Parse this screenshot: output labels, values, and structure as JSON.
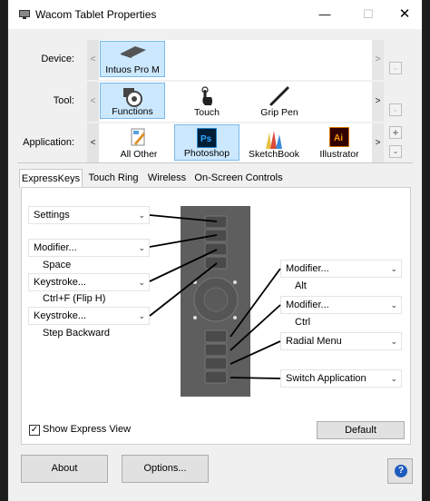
{
  "window": {
    "title": "Wacom Tablet Properties"
  },
  "titlebar": {
    "minimize": "—",
    "maximize": "☐",
    "close": "✕"
  },
  "device": {
    "label": "Device:",
    "items": [
      {
        "name": "Intuos Pro M",
        "icon": "tablet-icon",
        "selected": true
      }
    ]
  },
  "tool": {
    "label": "Tool:",
    "items": [
      {
        "name": "Functions",
        "icon": "functions-icon",
        "selected": true
      },
      {
        "name": "Touch",
        "icon": "touch-icon",
        "selected": false
      },
      {
        "name": "Grip Pen",
        "icon": "pen-icon",
        "selected": false
      }
    ]
  },
  "application": {
    "label": "Application:",
    "items": [
      {
        "name": "All Other",
        "icon": "all-other-icon",
        "selected": false
      },
      {
        "name": "Photoshop",
        "icon": "photoshop-icon",
        "icon_text": "Ps",
        "selected": true
      },
      {
        "name": "SketchBook",
        "icon": "sketchbook-icon",
        "selected": false
      },
      {
        "name": "Illustrator",
        "icon": "illustrator-icon",
        "icon_text": "Ai",
        "selected": false
      }
    ],
    "add": "+",
    "remove": "-"
  },
  "tabs": [
    "ExpressKeys",
    "Touch Ring",
    "Wireless",
    "On-Screen Controls"
  ],
  "active_tab": "ExpressKeys",
  "left_keys": [
    {
      "label": "Settings",
      "detail": ""
    },
    {
      "label": "Modifier...",
      "detail": "Space"
    },
    {
      "label": "Keystroke...",
      "detail": "Ctrl+F (Flip H)"
    },
    {
      "label": "Keystroke...",
      "detail": "Step Backward"
    }
  ],
  "right_keys": [
    {
      "label": "Modifier...",
      "detail": "Alt"
    },
    {
      "label": "Modifier...",
      "detail": "Ctrl"
    },
    {
      "label": "Radial Menu",
      "detail": ""
    },
    {
      "label": "Switch Application",
      "detail": ""
    }
  ],
  "show_express_view": {
    "label": "Show Express View",
    "checked": true,
    "mark": "✓"
  },
  "buttons": {
    "default": "Default",
    "about": "About",
    "options": "Options...",
    "help": "?"
  },
  "colors": {
    "selection_bg": "#cce8ff",
    "selection_border": "#7ab8e8",
    "photoshop": "#001e36",
    "illustrator": "#330000",
    "tablet": "#5e5e5e",
    "help": "#1e5bbf"
  }
}
